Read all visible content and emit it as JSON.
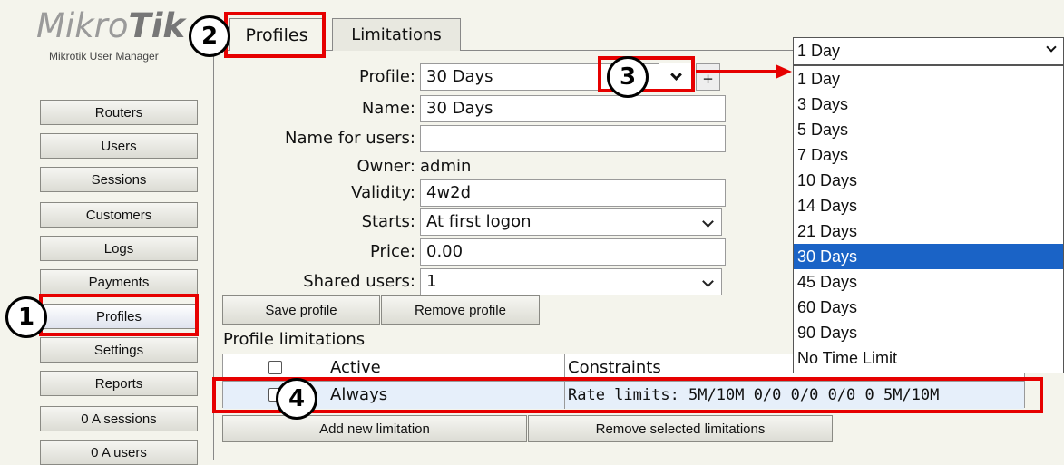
{
  "logo": {
    "light": "Mikro",
    "bold": "Tik",
    "subtitle": "Mikrotik User Manager"
  },
  "sidebar": {
    "items": [
      {
        "label": "Routers"
      },
      {
        "label": "Users"
      },
      {
        "label": "Sessions"
      },
      {
        "label": "Customers"
      },
      {
        "label": "Logs"
      },
      {
        "label": "Payments"
      },
      {
        "label": "Profiles"
      },
      {
        "label": "Settings"
      },
      {
        "label": "Reports"
      },
      {
        "label": "0 A sessions"
      },
      {
        "label": "0 A users"
      }
    ]
  },
  "tabs": {
    "profiles": "Profiles",
    "limitations": "Limitations"
  },
  "form": {
    "profile_label": "Profile:",
    "profile_value": "30 Days",
    "plus": "+",
    "name_label": "Name:",
    "name_value": "30 Days",
    "name_for_users_label": "Name for users:",
    "name_for_users_value": "",
    "owner_label": "Owner:",
    "owner_value": "admin",
    "validity_label": "Validity:",
    "validity_value": "4w2d",
    "starts_label": "Starts:",
    "starts_value": "At first logon",
    "price_label": "Price:",
    "price_value": "0.00",
    "shared_users_label": "Shared users:",
    "shared_users_value": "1"
  },
  "buttons": {
    "save_profile": "Save profile",
    "remove_profile": "Remove profile"
  },
  "limitations": {
    "title": "Profile limitations",
    "columns": {
      "active": "Active",
      "constraints": "Constraints"
    },
    "rows": [
      {
        "active": "Always",
        "constraints": "Rate limits: 5M/10M 0/0 0/0 0/0 0 5M/10M"
      }
    ],
    "add_button": "Add new limitation",
    "remove_button": "Remove selected limitations"
  },
  "dropdown": {
    "current": "1 Day",
    "options": [
      "1 Day",
      "3 Days",
      "5 Days",
      "7 Days",
      "10 Days",
      "14 Days",
      "21 Days",
      "30 Days",
      "45 Days",
      "60 Days",
      "90 Days",
      "No Time Limit"
    ],
    "selected_option": "30 Days"
  },
  "annotations": {
    "m1": "1",
    "m2": "2",
    "m3": "3",
    "m4": "4"
  },
  "colors": {
    "highlight_red": "#e60000",
    "selection_blue": "#1a63c6"
  }
}
